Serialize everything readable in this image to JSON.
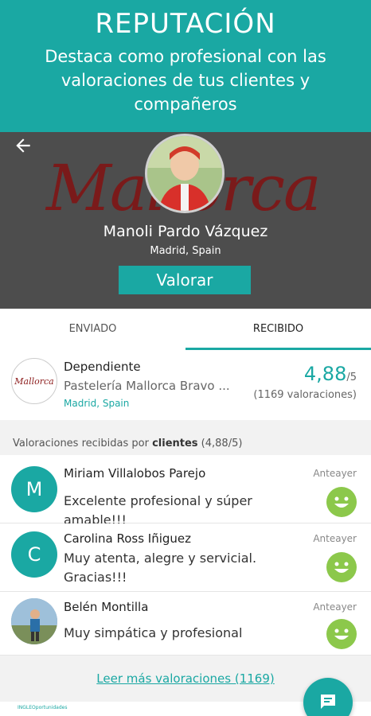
{
  "promo": {
    "title": "REPUTACIÓN",
    "subtitle": "Destaca como profesional con las valoraciones de tus clientes y compañeros"
  },
  "profile": {
    "background_logo": "Mallorca",
    "name": "Manoli Pardo Vázquez",
    "location": "Madrid, Spain",
    "rate_button": "Valorar"
  },
  "tabs": [
    "ENVIADO",
    "RECIBIDO"
  ],
  "job": {
    "logo_text": "Mallorca",
    "title": "Dependiente",
    "company": "Pastelería Mallorca Bravo ...",
    "location": "Madrid, Spain",
    "score": "4,88",
    "score_den": "/5",
    "count": "(1169 valoraciones)"
  },
  "section": {
    "prefix": "Valoraciones recibidas por ",
    "highlight": "clientes",
    "suffix": " (4,88/5)"
  },
  "reviews": [
    {
      "initial": "M",
      "name": "Miriam Villalobos Parejo",
      "date": "Anteayer",
      "text": "Excelente profesional y súper amable!!!"
    },
    {
      "initial": "C",
      "name": "Carolina Ross Iñiguez",
      "date": "Anteayer",
      "text": "Muy atenta, alegre y servicial. Gracias!!!"
    },
    {
      "initial": "",
      "name": "Belén Montilla",
      "date": "Anteayer",
      "text": "Muy simpática y profesional"
    }
  ],
  "more_link": "Leer más valoraciones (1169)",
  "brand_mini": "INGLEOportunidades",
  "colors": {
    "accent": "#1aa8a3",
    "header_bg": "#4d4d4d",
    "smiley": "#8cc84b"
  }
}
